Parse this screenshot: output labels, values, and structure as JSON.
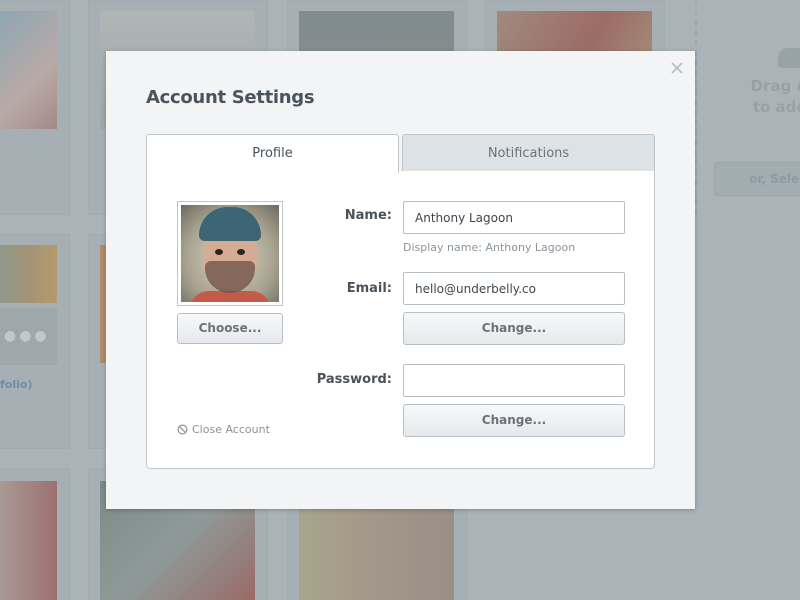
{
  "background": {
    "gallery_labels": [
      "folio)"
    ],
    "dropzone": {
      "text": "Drag & to add",
      "button_label": "or, Select"
    }
  },
  "modal": {
    "title": "Account Settings",
    "close_icon": "close-icon",
    "tabs": [
      {
        "label": "Profile",
        "active": true
      },
      {
        "label": "Notifications",
        "active": false
      }
    ],
    "profile": {
      "avatar_alt": "Profile photo",
      "choose_label": "Choose...",
      "name": {
        "label": "Name:",
        "value": "Anthony Lagoon",
        "hint": "Display name: Anthony Lagoon"
      },
      "email": {
        "label": "Email:",
        "value": "hello@underbelly.co",
        "change_label": "Change..."
      },
      "password": {
        "label": "Password:",
        "value": "",
        "change_label": "Change..."
      },
      "close_account": {
        "icon": "prohibited-icon",
        "label": "Close Account"
      }
    }
  },
  "colors": {
    "overlay": "#aab4b8",
    "modal_bg": "#f2f4f6",
    "panel_border": "#bec6cc",
    "text_primary": "#4a525a",
    "text_muted": "#8c959c"
  }
}
